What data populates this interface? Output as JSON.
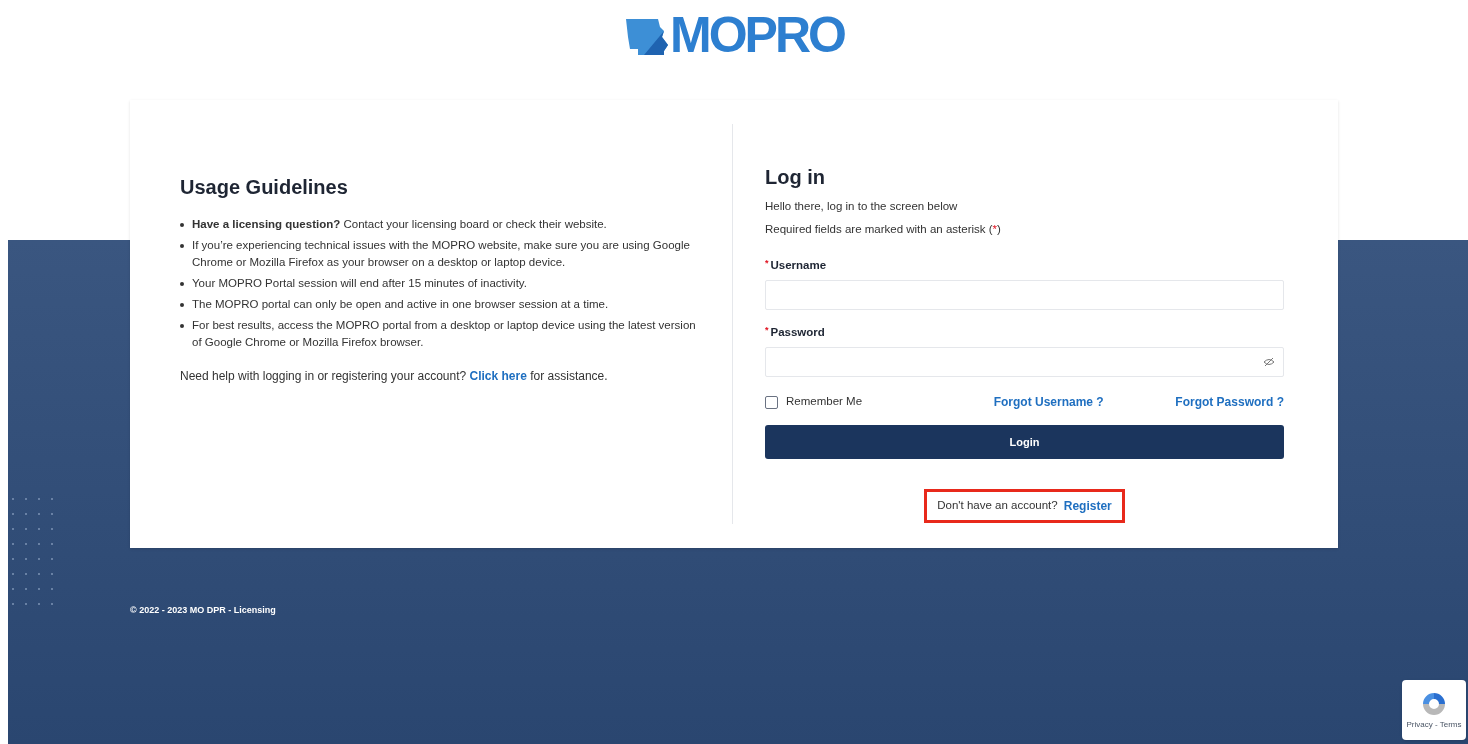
{
  "logo": {
    "text": "MOPRO"
  },
  "guidelines": {
    "title": "Usage Guidelines",
    "items": [
      "**Have a licensing question?** Contact your licensing board or check their website.",
      "If you’re experiencing technical issues with the MOPRO website, make sure you are using Google Chrome or Mozilla Firefox as your browser on a desktop or laptop device.",
      "Your MOPRO Portal session will end after 15 minutes of inactivity.",
      "The MOPRO portal can only be open and active in one browser session at a time.",
      "For best results, access the MOPRO portal from a desktop or laptop device using the latest version of Google Chrome or Mozilla Firefox browser."
    ],
    "help": {
      "before": "Need help with logging in or registering your account?",
      "link": "Click here",
      "after": "for assistance."
    }
  },
  "login": {
    "title": "Log in",
    "intro": "Hello there, log in to the screen below",
    "required_note": {
      "text": "Required fields are marked with an asterisk (",
      "mark": "*",
      "end": ")"
    },
    "fields": [
      {
        "kind": "text",
        "required_mark": "*",
        "label": "Username"
      },
      {
        "kind": "password",
        "required_mark": "*",
        "label": "Password"
      }
    ],
    "remember": {
      "label": "Remember Me",
      "checked": false
    },
    "forgot_username": "Forgot Username ?",
    "forgot_password": "Forgot Password ?",
    "button": "Login",
    "register": {
      "prompt": "Don't have an account?",
      "link": "Register"
    }
  },
  "footer": {
    "copyright": "© 2022 - 2023 MO DPR - Licensing"
  },
  "recaptcha": {
    "text": "Privacy - Terms"
  }
}
